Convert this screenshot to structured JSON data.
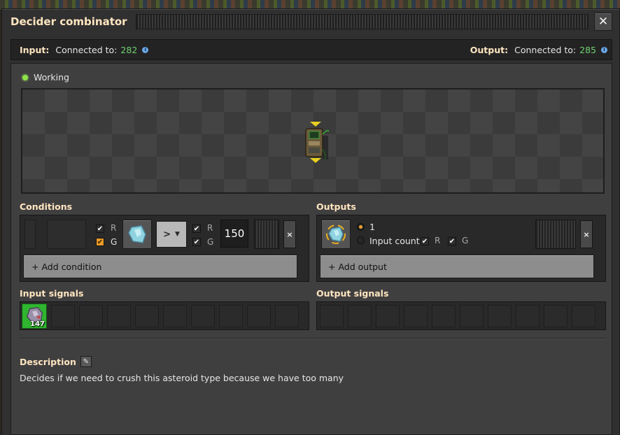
{
  "window": {
    "title": "Decider combinator"
  },
  "connection": {
    "input_label": "Input:",
    "input_connected_text": "Connected to:",
    "input_count": "282",
    "output_label": "Output:",
    "output_connected_text": "Connected to:",
    "output_count": "285"
  },
  "status": {
    "text": "Working"
  },
  "conditions": {
    "label": "Conditions",
    "first_signal": {
      "red": {
        "label": "R",
        "checked": true
      },
      "green": {
        "label": "G",
        "checked": true
      }
    },
    "signal_icon": "asteroid-chunk-icon",
    "comparator": ">",
    "second_signal": {
      "red": {
        "label": "R",
        "checked": true
      },
      "green": {
        "label": "G",
        "checked": true
      }
    },
    "constant": "150",
    "remove_label": "×",
    "add_label": "+ Add condition"
  },
  "outputs": {
    "label": "Outputs",
    "signal_icon": "asteroid-chunk-icon",
    "option_value": "1",
    "option_input_count": "Input count",
    "red": {
      "label": "R",
      "checked": true
    },
    "green": {
      "label": "G",
      "checked": true
    },
    "remove_label": "×",
    "add_label": "+ Add output"
  },
  "input_signals": {
    "label": "Input signals",
    "items": [
      {
        "icon": "asteroid-chunk-icon",
        "count": "147"
      }
    ]
  },
  "output_signals": {
    "label": "Output signals"
  },
  "description": {
    "label": "Description",
    "text": "Decides if we need to crush this asteroid type because we have too many"
  },
  "colors": {
    "accent_title": "#ffe6c0",
    "connected_count": "#6ed36e",
    "status_ok": "#8ee24a",
    "green_wire": "#2fb52f",
    "red_wire": "#c82828"
  }
}
